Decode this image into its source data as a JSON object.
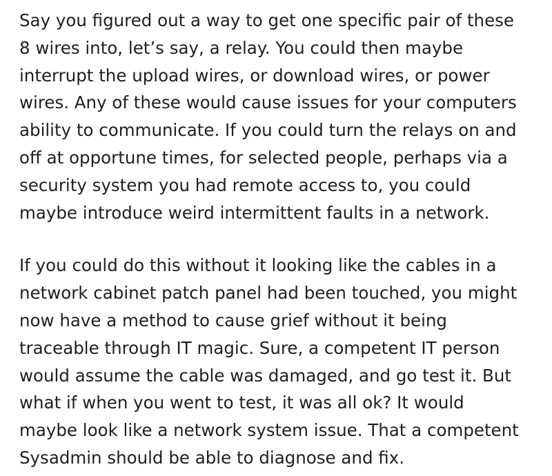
{
  "post": {
    "paragraphs": [
      {
        "lines": [
          "Say you figured out a way to get one specific pair of these",
          "8 wires into, let’s say, a relay. You could then maybe",
          "interrupt the upload wires, or download wires, or power",
          "wires. Any of these would cause issues for your computers",
          "ability to communicate. If you could turn the relays on and",
          "off at opportune times, for selected people, perhaps via a",
          "security system you had remote access to, you could",
          "maybe introduce weird intermittent faults in a network."
        ]
      },
      {
        "lines": [
          "If you could do this without it looking like the cables in a",
          "network cabinet patch panel had been touched, you might",
          "now have a method to cause grief without it being",
          "traceable through IT magic. Sure, a competent IT person",
          "would assume the cable was damaged, and go test it. But",
          "what if when you went to test, it was all ok? It would",
          "maybe look like a network system issue. That a competent",
          "Sysadmin should be able to diagnose and fix."
        ]
      }
    ]
  }
}
